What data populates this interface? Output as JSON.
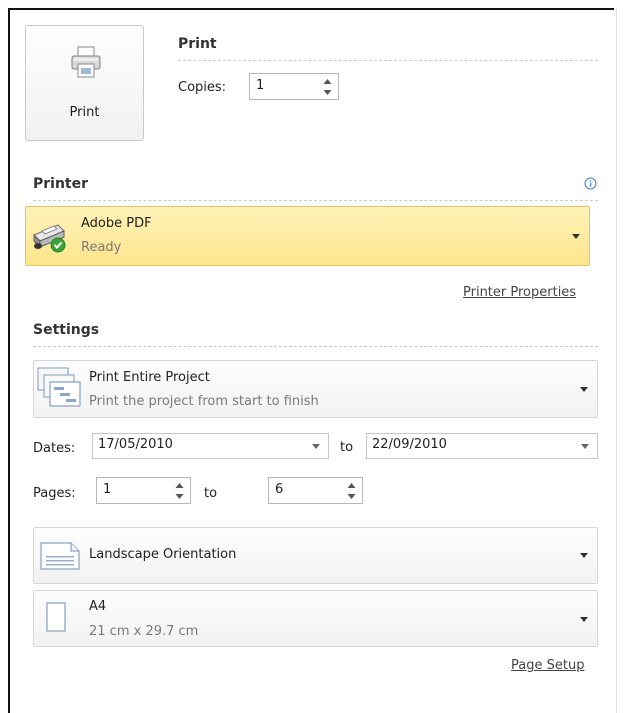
{
  "print": {
    "button_label": "Print",
    "section_title": "Print",
    "copies_label": "Copies:",
    "copies_value": "1"
  },
  "printer": {
    "section_title": "Printer",
    "name": "Adobe PDF",
    "status": "Ready",
    "properties_link": "Printer Properties",
    "info_icon": "info-icon"
  },
  "settings": {
    "section_title": "Settings",
    "scope": {
      "title": "Print Entire Project",
      "subtitle": "Print the project from start to finish"
    },
    "dates": {
      "label": "Dates:",
      "from": "17/05/2010",
      "to_label": "to",
      "to": "22/09/2010"
    },
    "pages": {
      "label": "Pages:",
      "from": "1",
      "to_label": "to",
      "to": "6"
    },
    "orientation": {
      "title": "Landscape Orientation"
    },
    "paper": {
      "title": "A4",
      "subtitle": "21 cm x 29.7 cm"
    },
    "page_setup_link": "Page Setup"
  },
  "colors": {
    "highlight_top": "#fff3b8",
    "highlight_bottom": "#fde58c",
    "highlight_border": "#e8c25e",
    "ready_green": "#3aa335",
    "info_blue": "#3c7fd0"
  }
}
